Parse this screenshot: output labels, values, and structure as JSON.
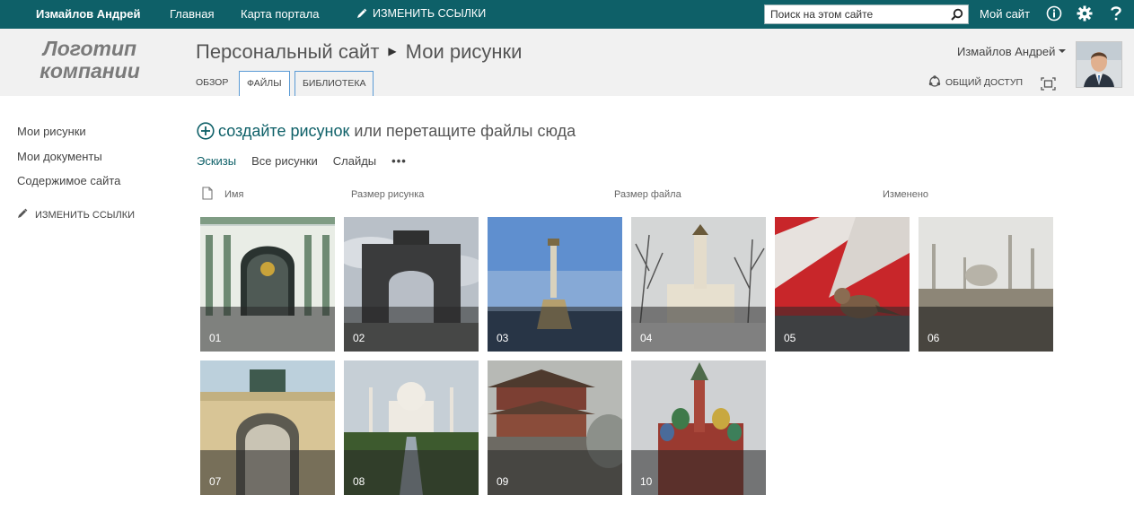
{
  "suitebar": {
    "user": "Измайлов Андрей",
    "nav": [
      "Главная",
      "Карта портала"
    ],
    "edit_links": "ИЗМЕНИТЬ ССЫЛКИ",
    "search_placeholder": "Поиск на этом сайте",
    "my_site": "Мой сайт",
    "icons": [
      "search-icon",
      "info-icon",
      "gear-icon",
      "help-icon"
    ]
  },
  "header": {
    "logo_line1": "Логотип",
    "logo_line2": "компании",
    "breadcrumb": [
      "Персональный сайт",
      "Мои рисунки"
    ],
    "tabs": [
      "ОБЗОР",
      "ФАЙЛЫ",
      "БИБЛИОТЕКА"
    ],
    "active_tab": "ФАЙЛЫ",
    "username": "Измайлов Андрей",
    "share": "ОБЩИЙ ДОСТУП"
  },
  "leftnav": {
    "items": [
      "Мои рисунки",
      "Мои документы",
      "Содержимое сайта"
    ],
    "edit_links": "ИЗМЕНИТЬ ССЫЛКИ"
  },
  "main": {
    "create_text": "создайте рисунок",
    "drag_text": " или перетащите файлы сюда",
    "views": [
      "Эскизы",
      "Все рисунки",
      "Слайды"
    ],
    "more": "•••",
    "columns": [
      "Имя",
      "Размер рисунка",
      "Размер файла",
      "Изменено"
    ],
    "pictures": [
      "01",
      "02",
      "03",
      "04",
      "05",
      "06",
      "07",
      "08",
      "09",
      "10"
    ]
  },
  "colors": {
    "suitebar_bg": "#0e6068",
    "accent": "#0e6068",
    "header_bg": "#f1f1f1"
  }
}
